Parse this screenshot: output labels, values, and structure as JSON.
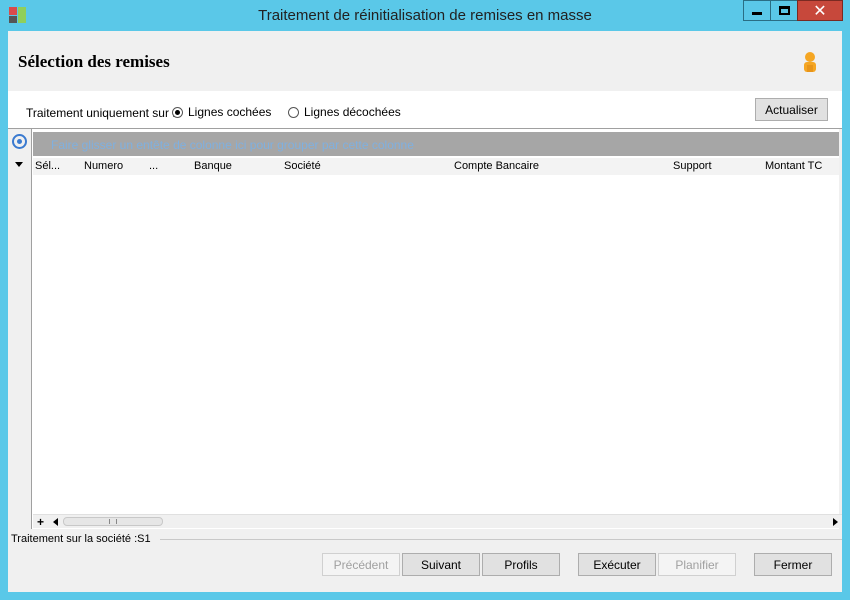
{
  "window": {
    "title": "Traitement de réinitialisation de remises en masse",
    "close_glyph": "✕"
  },
  "header": {
    "page_title": "Sélection des remises"
  },
  "options": {
    "label": "Traitement uniquement sur :",
    "radio_checked_label": "Lignes cochées",
    "radio_unchecked_label": "Lignes décochées",
    "selected": "Lignes cochées",
    "refresh_label": "Actualiser"
  },
  "grid": {
    "group_hint": "Faire glisser un entête de colonne ici pour grouper par cette colonne",
    "columns": [
      "Sél...",
      "Numero",
      "...",
      "Banque",
      "Société",
      "Compte Bancaire",
      "Support",
      "Montant TC"
    ],
    "rows": [],
    "plus_glyph": "+"
  },
  "status": {
    "text": "Traitement sur la société :S1"
  },
  "buttons": {
    "prev": "Précédent",
    "next": "Suivant",
    "profils": "Profils",
    "exec": "Exécuter",
    "plan": "Planifier",
    "close": "Fermer"
  },
  "colors": {
    "titlebar": "#5ac8e8",
    "close_button": "#c7483b",
    "group_bar": "#a6a6a6"
  },
  "icons": [
    "app-icon",
    "minimize-icon",
    "maximize-icon",
    "close-icon",
    "user-icon",
    "target-icon",
    "expand-arrow-icon"
  ]
}
